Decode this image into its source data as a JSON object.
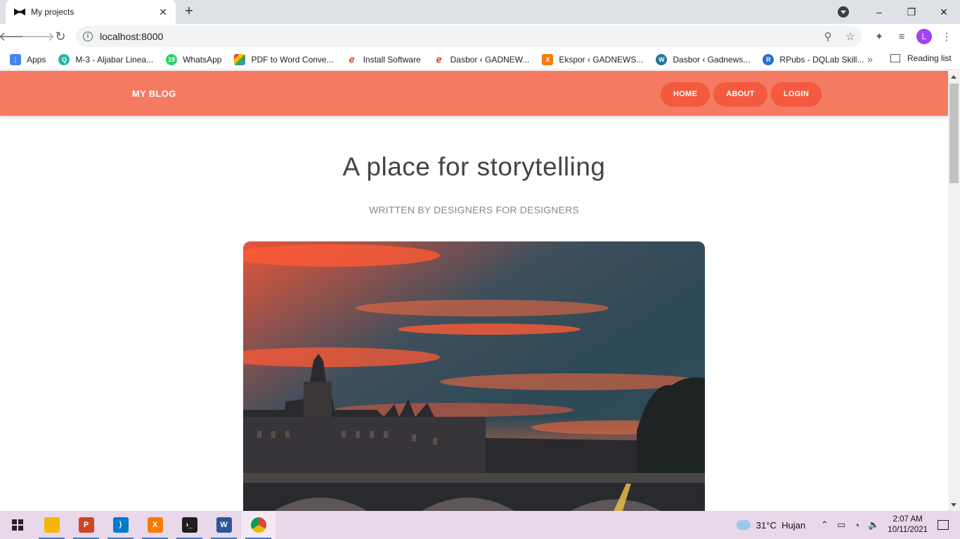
{
  "browser": {
    "tab_title": "My projects",
    "url": "localhost:8000",
    "avatar_letter": "L",
    "bookmarks": [
      {
        "label": "Apps",
        "icon": "apps-grid-icon",
        "color": "#4285f4"
      },
      {
        "label": "M-3 - Aljabar Linea...",
        "icon": "quizizz-icon",
        "color": "#2ab3a6"
      },
      {
        "label": "WhatsApp",
        "icon": "whatsapp-icon",
        "color": "#25d366"
      },
      {
        "label": "PDF to Word Conve...",
        "icon": "pdf-converter-icon",
        "color": "#e94235"
      },
      {
        "label": "Install Software",
        "icon": "install-icon",
        "color": "#d93025"
      },
      {
        "label": "Dasbor ‹ GADNEW...",
        "icon": "dashboard-icon",
        "color": "#d93025"
      },
      {
        "label": "Ekspor ‹ GADNEWS...",
        "icon": "xampp-icon",
        "color": "#f57c00"
      },
      {
        "label": "Dasbor ‹ Gadnews...",
        "icon": "wordpress-icon",
        "color": "#21759b"
      },
      {
        "label": "RPubs - DQLab Skill...",
        "icon": "rpubs-icon",
        "color": "#276dc3"
      }
    ],
    "reading_list": "Reading list"
  },
  "site": {
    "brand": "MY BLOG",
    "nav": [
      "HOME",
      "ABOUT",
      "LOGIN"
    ],
    "hero_title": "A place for storytelling",
    "hero_subtitle": "WRITTEN BY DESIGNERS FOR DESIGNERS",
    "accent_color": "#f47a62",
    "button_color": "#f35a40"
  },
  "taskbar": {
    "apps": [
      {
        "name": "windows-start-icon",
        "color": "#222222"
      },
      {
        "name": "file-explorer-icon",
        "color": "#f2b705"
      },
      {
        "name": "powerpoint-icon",
        "color": "#d04423"
      },
      {
        "name": "vscode-icon",
        "color": "#007acc"
      },
      {
        "name": "xampp-icon",
        "color": "#f57c00"
      },
      {
        "name": "terminal-icon",
        "color": "#1e1e1e"
      },
      {
        "name": "word-icon",
        "color": "#2b579a"
      },
      {
        "name": "chrome-icon",
        "color": "#db4437"
      }
    ],
    "weather_temp": "31°C",
    "weather_text": "Hujan",
    "time": "2:07 AM",
    "date": "10/11/2021"
  }
}
